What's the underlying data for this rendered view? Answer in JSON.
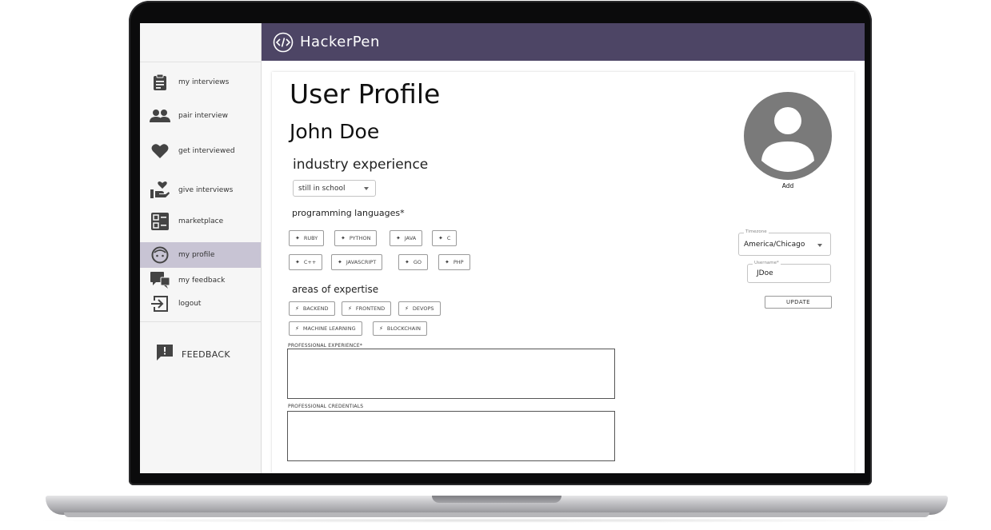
{
  "app": {
    "title": "HackerPen"
  },
  "sidebar": {
    "items": [
      {
        "label": "my interviews",
        "icon": "clipboard-icon"
      },
      {
        "label": "pair interview",
        "icon": "people-icon"
      },
      {
        "label": "get interviewed",
        "icon": "heart-icon"
      },
      {
        "label": "give interviews",
        "icon": "hand-heart-icon"
      },
      {
        "label": "marketplace",
        "icon": "list-grid-icon"
      },
      {
        "label": "my profile",
        "icon": "face-icon",
        "active": true
      },
      {
        "label": "my feedback",
        "icon": "chat-bubbles-icon"
      },
      {
        "label": "logout",
        "icon": "logout-icon"
      }
    ],
    "feedback_label": "FEEDBACK"
  },
  "profile": {
    "page_title": "User Profile",
    "user_name": "John Doe",
    "industry_heading": "industry experience",
    "industry_value": "still in school",
    "languages_heading": "programming languages*",
    "languages": [
      "RUBY",
      "PYTHON",
      "JAVA",
      "C",
      "C++",
      "JAVASCRIPT",
      "GO",
      "PHP"
    ],
    "expertise_heading": "areas of expertise",
    "expertise": [
      "BACKEND",
      "FRONTEND",
      "DEVOPS",
      "MACHINE LEARNING",
      "BLOCKCHAIN"
    ],
    "professional_experience_label": "PROFESSIONAL EXPERIENCE*",
    "professional_experience_value": "",
    "professional_credentials_label": "PROFESSIONAL CREDENTIALS",
    "professional_credentials_value": "",
    "avatar_add_label": "Add",
    "timezone_label": "Timezone",
    "timezone_value": "America/Chicago",
    "username_label": "Username*",
    "username_value": "JDoe",
    "update_label": "UPDATE"
  },
  "colors": {
    "header_bg": "#4d4565",
    "active_nav_bg": "#c8c4d4",
    "avatar_gray": "#7a7a7a"
  }
}
